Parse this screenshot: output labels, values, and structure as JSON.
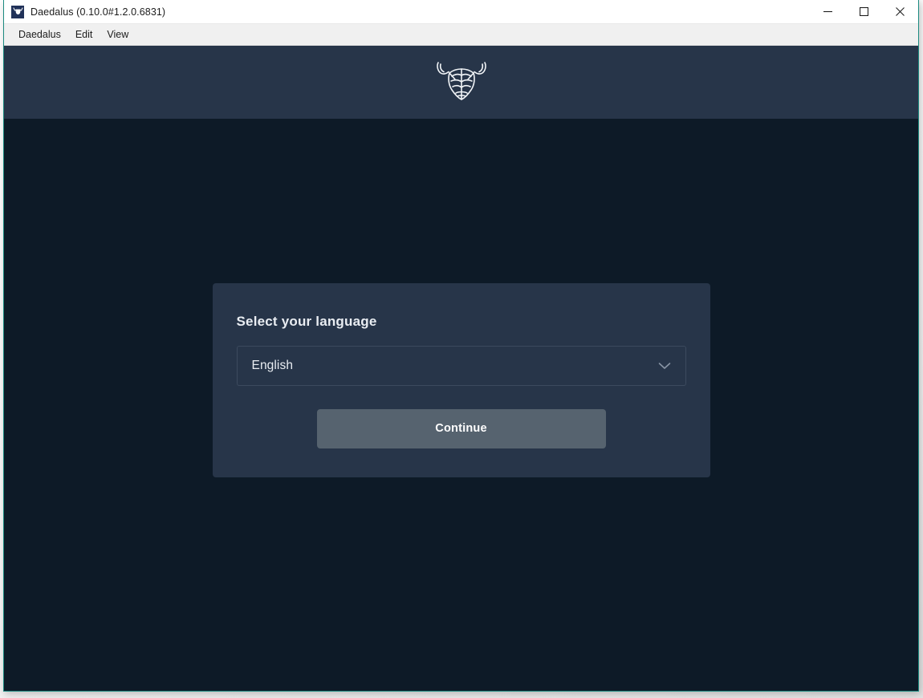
{
  "window": {
    "title": "Daedalus (0.10.0#1.2.0.6831)",
    "app_icon": "bull-logo-icon",
    "controls": {
      "minimize_label": "Minimize",
      "maximize_label": "Maximize",
      "close_label": "Close"
    }
  },
  "menu_bar": {
    "items": [
      {
        "label": "Daedalus"
      },
      {
        "label": "Edit"
      },
      {
        "label": "View"
      }
    ]
  },
  "brand_header": {
    "logo_icon": "daedalus-bull-logo"
  },
  "language_card": {
    "title": "Select your language",
    "select": {
      "value": "English",
      "chevron_icon": "chevron-down-icon",
      "options": [
        "English"
      ]
    },
    "continue_label": "Continue"
  },
  "colors": {
    "window_border": "#1b8a80",
    "title_bar_bg": "#ffffff",
    "menu_bar_bg": "#f0f0f0",
    "app_background": "#0d1a27",
    "header_band": "#273549",
    "card_background": "#273549",
    "card_text": "#e9edf2",
    "select_border": "#3c4a5e",
    "button_background": "#56636f",
    "button_text": "#ffffff"
  }
}
